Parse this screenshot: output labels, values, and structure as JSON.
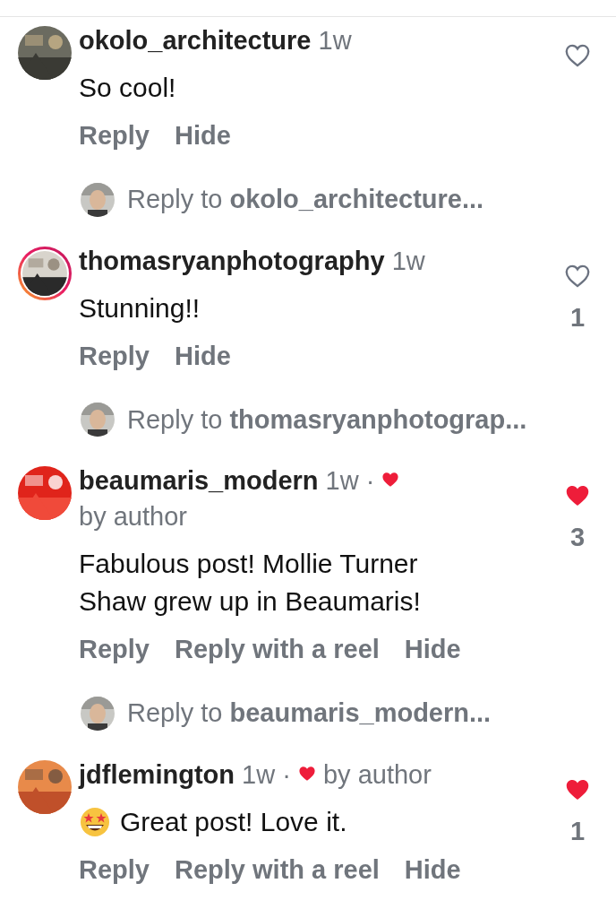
{
  "comments": [
    {
      "username": "okolo_architecture",
      "time": "1w",
      "liked_by_author": false,
      "story_ring": false,
      "text": "So cool!",
      "emoji": false,
      "liked": false,
      "actions": [
        "Reply",
        "Hide"
      ],
      "reply_prompt": "Reply to **okolo_architecture...**"
    },
    {
      "username": "thomasryanphotography",
      "time": "1w",
      "liked_by_author": false,
      "story_ring": true,
      "text": "Stunning!!",
      "emoji": false,
      "liked": false,
      "like_count": "1",
      "actions": [
        "Reply",
        "Hide"
      ],
      "reply_prompt": "Reply to **thomasryanphotograp...**"
    },
    {
      "username": "beaumaris_modern",
      "time": "1w ·",
      "liked_by_author": true,
      "author_label": "by author",
      "story_ring": false,
      "text": "Fabulous post! Mollie Turner Shaw grew up in Beaumaris!",
      "emoji": false,
      "liked": true,
      "like_count": "3",
      "actions": [
        "Reply",
        "Reply with a reel",
        "Hide"
      ],
      "reply_prompt": "Reply to **beaumaris_modern...**"
    },
    {
      "username": "jdflemington",
      "time": "1w ·",
      "liked_by_author": true,
      "author_label": "by author",
      "story_ring": false,
      "text": "Great post! Love it.",
      "emoji": true,
      "liked": true,
      "like_count": "1",
      "actions": [
        "Reply",
        "Reply with a reel",
        "Hide"
      ]
    }
  ]
}
